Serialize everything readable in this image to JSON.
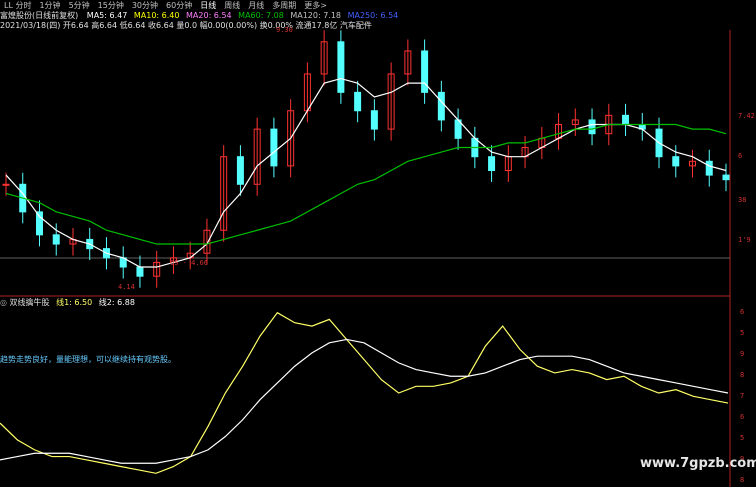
{
  "tabs": [
    "1分钟",
    "5分钟",
    "15分钟",
    "30分钟",
    "60分钟",
    "日线",
    "周线",
    "月线",
    "多周期",
    "更多>"
  ],
  "tab_prefix": "LL 分时",
  "info": {
    "stock": "富煌股份(日线前复权)",
    "ma5": "MA5: 6.47",
    "ma10": "MA10: 6.40",
    "ma20": "MA20: 6.54",
    "ma60": "MA60: 7.08",
    "ma120": "MA120: 7.18",
    "ma250": "MA250: 6.54",
    "date": "2021/03/18(四)",
    "ohlc": "开6.64 高6.64 低6.64 收6.64 量0.0 幅0.00(0.00%) 换0.00% 流通17.8亿 汽车配件"
  },
  "indicator": {
    "title": "双线擒牛股",
    "line1": "线1: 6.50",
    "line2": "线2: 6.88"
  },
  "note": "趋势走势良好，量能理想，可以继续持有观势股。",
  "watermark": "www.7gpzb.com",
  "colors": {
    "up": "#ff3232",
    "down": "#54ffff",
    "ma5": "#ffffff",
    "ma10": "#ffff00",
    "ma20": "#ff80ff",
    "ma60": "#00c000",
    "line1": "#ffff66",
    "line2": "#ffffff"
  },
  "chart_data": [
    {
      "type": "line",
      "title": "富煌股份(日线前复权)",
      "annotations": [
        {
          "text": "9.30",
          "kind": "high"
        },
        {
          "text": "4.14",
          "kind": "low"
        },
        {
          "text": "65 - 4.66",
          "kind": "range"
        }
      ],
      "y_tick_labels": [
        "7.42",
        "6",
        "38",
        "1'9"
      ],
      "series": [
        {
          "name": "收盘",
          "values": [
            6.2,
            5.6,
            5.1,
            4.9,
            5.0,
            4.8,
            4.6,
            4.4,
            4.2,
            4.5,
            4.6,
            4.7,
            5.2,
            6.8,
            6.2,
            7.4,
            6.6,
            7.8,
            8.6,
            9.3,
            8.2,
            7.8,
            7.4,
            8.6,
            9.1,
            8.2,
            7.6,
            7.2,
            6.8,
            6.5,
            6.8,
            7.0,
            7.2,
            7.5,
            7.6,
            7.3,
            7.7,
            7.5,
            7.4,
            6.8,
            6.6,
            6.7,
            6.4,
            6.3
          ]
        },
        {
          "name": "MA5",
          "values": [
            6.4,
            6.0,
            5.5,
            5.2,
            5.0,
            4.9,
            4.7,
            4.6,
            4.4,
            4.4,
            4.5,
            4.6,
            4.9,
            5.6,
            6.0,
            6.6,
            6.9,
            7.2,
            7.8,
            8.4,
            8.5,
            8.4,
            8.1,
            8.2,
            8.4,
            8.4,
            8.0,
            7.6,
            7.2,
            6.9,
            6.8,
            6.8,
            7.0,
            7.2,
            7.4,
            7.5,
            7.5,
            7.5,
            7.4,
            7.1,
            6.9,
            6.8,
            6.6,
            6.5
          ]
        },
        {
          "name": "MA60",
          "values": [
            6.0,
            5.9,
            5.8,
            5.6,
            5.5,
            5.4,
            5.2,
            5.1,
            5.0,
            4.9,
            4.9,
            4.9,
            4.9,
            5.0,
            5.1,
            5.2,
            5.3,
            5.4,
            5.6,
            5.8,
            6.0,
            6.2,
            6.3,
            6.5,
            6.7,
            6.8,
            6.9,
            7.0,
            7.0,
            7.0,
            7.1,
            7.1,
            7.2,
            7.3,
            7.4,
            7.4,
            7.5,
            7.5,
            7.5,
            7.5,
            7.5,
            7.4,
            7.4,
            7.3
          ]
        }
      ]
    },
    {
      "type": "line",
      "title": "双线擒牛股",
      "y_tick_labels": [
        "6",
        "5",
        "9",
        "8",
        "7",
        "6",
        "5",
        "9",
        "8"
      ],
      "series": [
        {
          "name": "线1",
          "values": [
            5.9,
            5.4,
            5.1,
            4.9,
            4.9,
            4.8,
            4.7,
            4.6,
            4.5,
            4.4,
            4.6,
            4.9,
            5.8,
            6.8,
            7.6,
            8.5,
            9.2,
            8.9,
            8.8,
            9.0,
            8.4,
            7.8,
            7.2,
            6.8,
            7.0,
            7.0,
            7.1,
            7.3,
            8.2,
            8.8,
            8.1,
            7.6,
            7.4,
            7.5,
            7.4,
            7.2,
            7.3,
            7.0,
            6.8,
            6.9,
            6.7,
            6.6,
            6.5
          ]
        },
        {
          "name": "线2",
          "values": [
            4.8,
            4.9,
            5.0,
            5.0,
            5.0,
            4.9,
            4.8,
            4.7,
            4.7,
            4.7,
            4.8,
            4.9,
            5.1,
            5.5,
            6.0,
            6.6,
            7.1,
            7.6,
            8.0,
            8.3,
            8.4,
            8.3,
            8.0,
            7.7,
            7.5,
            7.4,
            7.3,
            7.3,
            7.4,
            7.6,
            7.8,
            7.9,
            7.9,
            7.9,
            7.8,
            7.6,
            7.4,
            7.3,
            7.2,
            7.1,
            7.0,
            6.9,
            6.8
          ]
        }
      ]
    }
  ]
}
